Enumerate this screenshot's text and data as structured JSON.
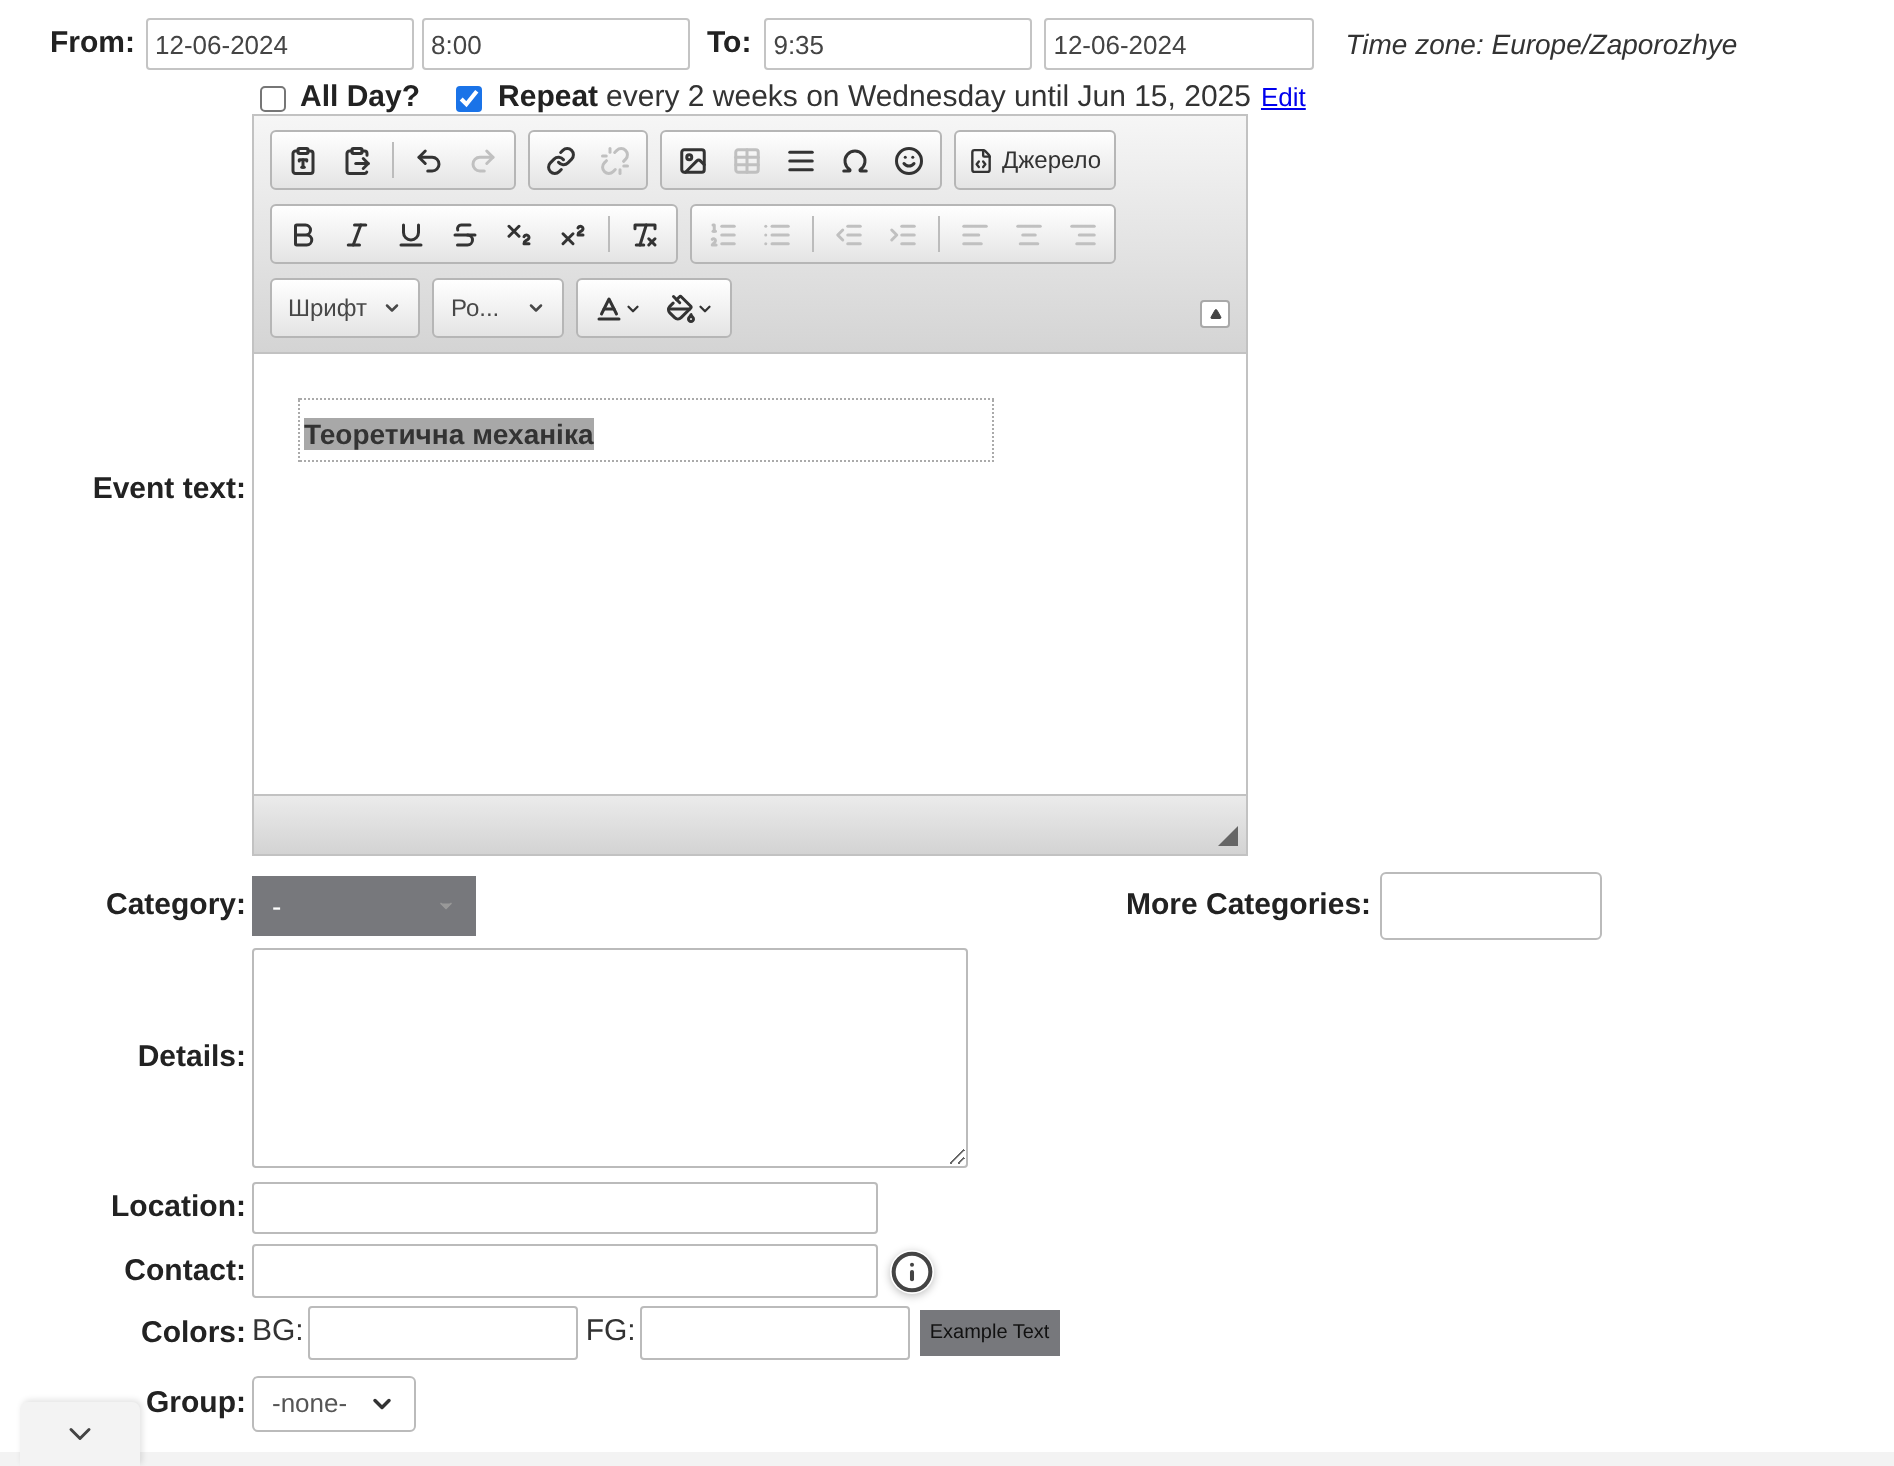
{
  "from": {
    "label": "From:",
    "date": "12-06-2024",
    "time": "8:00"
  },
  "to": {
    "label": "To:",
    "time": "9:35",
    "date": "12-06-2024"
  },
  "timezone": "Time zone: Europe/Zaporozhye",
  "all_day": {
    "label": "All Day?",
    "checked": false
  },
  "repeat": {
    "label": "Repeat",
    "checked": true,
    "summary": "every 2 weeks on Wednesday until Jun 15, 2025",
    "link": "Edit"
  },
  "event_text": {
    "label": "Event text:",
    "toolbar_rows": [
      [
        [
          {
            "kind": "paste-text",
            "disabled": false
          },
          {
            "kind": "paste-word",
            "disabled": false
          },
          {
            "kind": "separator"
          },
          {
            "kind": "undo",
            "disabled": false
          },
          {
            "kind": "redo",
            "disabled": true
          }
        ],
        [
          {
            "kind": "link",
            "disabled": false
          },
          {
            "kind": "unlink",
            "disabled": true
          }
        ],
        [
          {
            "kind": "image",
            "disabled": false
          },
          {
            "kind": "table",
            "disabled": true
          },
          {
            "kind": "horizontal-rule",
            "disabled": false
          },
          {
            "kind": "special-char",
            "disabled": false
          },
          {
            "kind": "smiley",
            "disabled": false
          }
        ],
        [
          {
            "kind": "source",
            "disabled": false,
            "label": "Джерело"
          }
        ]
      ],
      [
        [
          {
            "kind": "bold",
            "disabled": false
          },
          {
            "kind": "italic",
            "disabled": false
          },
          {
            "kind": "underline",
            "disabled": false
          },
          {
            "kind": "strike",
            "disabled": false
          },
          {
            "kind": "subscript",
            "disabled": false
          },
          {
            "kind": "superscript",
            "disabled": false
          },
          {
            "kind": "separator"
          },
          {
            "kind": "remove-format",
            "disabled": false
          }
        ],
        [
          {
            "kind": "numbered-list",
            "disabled": true
          },
          {
            "kind": "bulleted-list",
            "disabled": true
          },
          {
            "kind": "separator"
          },
          {
            "kind": "outdent",
            "disabled": true
          },
          {
            "kind": "indent",
            "disabled": true
          },
          {
            "kind": "separator"
          },
          {
            "kind": "align-left",
            "disabled": true
          },
          {
            "kind": "align-center",
            "disabled": true
          },
          {
            "kind": "align-right",
            "disabled": true
          }
        ]
      ],
      [
        [
          {
            "kind": "combo",
            "label": "Шрифт"
          }
        ],
        [
          {
            "kind": "combo",
            "label": "Ро..."
          }
        ],
        [
          {
            "kind": "text-color",
            "disabled": false
          },
          {
            "kind": "bg-color",
            "disabled": false
          }
        ]
      ]
    ],
    "content": "Теоретична механіка"
  },
  "category": {
    "label": "Category:",
    "value": "-"
  },
  "more_categories": {
    "label": "More Categories:"
  },
  "details": {
    "label": "Details:"
  },
  "location": {
    "label": "Location:"
  },
  "contact": {
    "label": "Contact:"
  },
  "colors": {
    "label": "Colors:",
    "bg_label": "BG:",
    "fg_label": "FG:",
    "example": "Example Text"
  },
  "group": {
    "label": "Group:",
    "value": "-none-"
  }
}
